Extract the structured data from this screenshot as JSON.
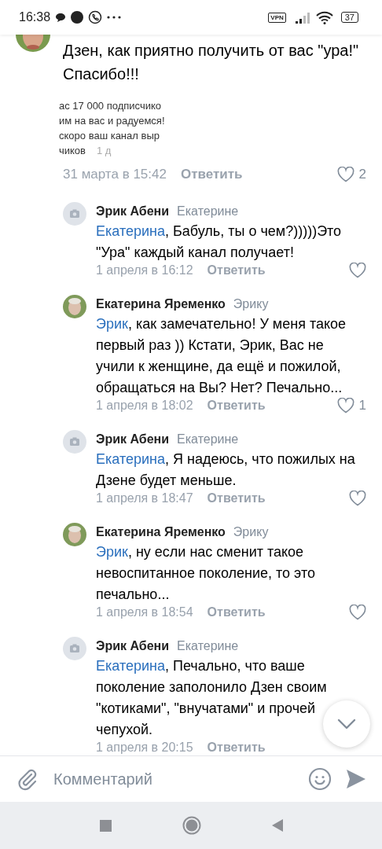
{
  "status_bar": {
    "time": "16:38",
    "vpn": "VPN",
    "battery": "37"
  },
  "top_comment": {
    "text": "Дзен, как приятно получить от вас \"ура!\" Спасибо!!!",
    "attachment_lines": [
      "ас 17 000 подписчико",
      "им на вас и радуемся!",
      "скоро ваш канал выр",
      "чиков"
    ],
    "attachment_time": "1 д",
    "date": "31 марта в 15:42",
    "reply_label": "Ответить",
    "likes": "2",
    "liked": false
  },
  "replies": [
    {
      "kind": "placeholder",
      "author": "Эрик Абени",
      "addressee": "Екатерине",
      "mention": "Екатерина",
      "text": ", Бабуль, ты о чем?)))))Это \"Ура\" каждый канал получает!",
      "date": "1 апреля в 16:12",
      "reply_label": "Ответить",
      "liked": false
    },
    {
      "author": "Екатерина Яременко",
      "addressee": "Эрику",
      "mention": "Эрик",
      "text": ", как замечательно! У меня такое первый раз )) Кстати, Эрик, Вас не учили к женщине, да ещё и пожилой, обращаться на Вы? Нет? Печально...",
      "date": "1 апреля в 18:02",
      "reply_label": "Ответить",
      "likes": "1",
      "liked": false
    },
    {
      "kind": "placeholder",
      "author": "Эрик Абени",
      "addressee": "Екатерине",
      "mention": "Екатерина",
      "text": ", Я надеюсь, что пожилых на Дзене будет меньше.",
      "date": "1 апреля в 18:47",
      "reply_label": "Ответить",
      "liked": false
    },
    {
      "author": "Екатерина Яременко",
      "addressee": "Эрику",
      "mention": "Эрик",
      "text": ", ну если нас сменит такое невоспитанное поколение, то это печально...",
      "date": "1 апреля в 18:54",
      "reply_label": "Ответить",
      "liked": false
    },
    {
      "kind": "placeholder",
      "author": "Эрик Абени",
      "addressee": "Екатерине",
      "mention": "Екатерина",
      "text": ", Печально, что ваше поколение заполонило Дзен своим \"котиками\", \"внучатами\" и прочей чепухой.",
      "date": "1 апреля в 20:15",
      "reply_label": "Ответить"
    }
  ],
  "composer": {
    "placeholder": "Комментарий"
  }
}
